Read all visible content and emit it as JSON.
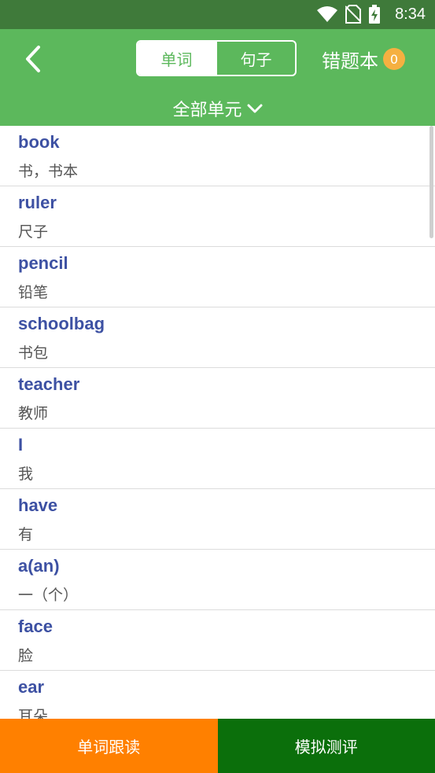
{
  "status": {
    "time": "8:34"
  },
  "header": {
    "tabs": [
      {
        "label": "单词",
        "active": true
      },
      {
        "label": "句子",
        "active": false
      }
    ],
    "wrong_book": {
      "label": "错题本",
      "count": "0"
    },
    "unit_selector": "全部单元"
  },
  "words": [
    {
      "word": "book",
      "meaning": "书，书本"
    },
    {
      "word": "ruler",
      "meaning": "尺子"
    },
    {
      "word": "pencil",
      "meaning": "铅笔"
    },
    {
      "word": "schoolbag",
      "meaning": "书包"
    },
    {
      "word": "teacher",
      "meaning": "教师"
    },
    {
      "word": "I",
      "meaning": "我"
    },
    {
      "word": "have",
      "meaning": "有"
    },
    {
      "word": "a(an)",
      "meaning": "一（个）"
    },
    {
      "word": "face",
      "meaning": "脸"
    },
    {
      "word": "ear",
      "meaning": "耳朵"
    }
  ],
  "bottom": {
    "follow_read": "单词跟读",
    "mock_test": "模拟测评"
  },
  "colors": {
    "header_bg": "#5cb85c",
    "statusbar_bg": "#3f7a3a",
    "word_text": "#3d51a3",
    "badge": "#f5b041",
    "follow_btn": "#ff8000",
    "test_btn": "#0b6f0b"
  }
}
